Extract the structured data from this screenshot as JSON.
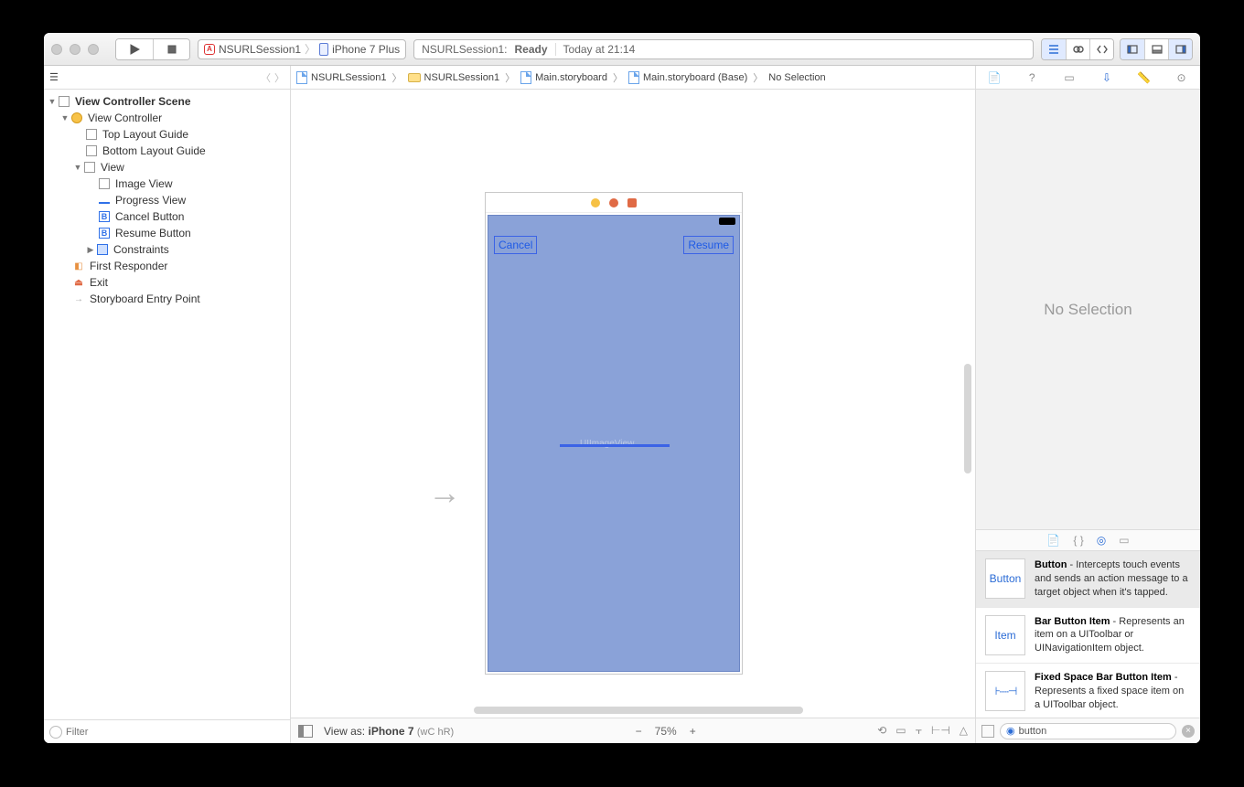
{
  "toolbar": {
    "scheme_target": "NSURLSession1",
    "scheme_device": "iPhone 7 Plus",
    "activity_project": "NSURLSession1:",
    "activity_status": "Ready",
    "activity_time": "Today at 21:14"
  },
  "breadcrumb": {
    "items": [
      "NSURLSession1",
      "NSURLSession1",
      "Main.storyboard",
      "Main.storyboard (Base)",
      "No Selection"
    ]
  },
  "outline": {
    "scene": "View Controller Scene",
    "vc": "View Controller",
    "top_guide": "Top Layout Guide",
    "bottom_guide": "Bottom Layout Guide",
    "view": "View",
    "image_view": "Image View",
    "progress_view": "Progress View",
    "cancel_button": "Cancel Button",
    "resume_button": "Resume Button",
    "constraints": "Constraints",
    "first_responder": "First Responder",
    "exit": "Exit",
    "entry_point": "Storyboard Entry Point"
  },
  "canvas": {
    "cancel_label": "Cancel",
    "resume_label": "Resume",
    "imageview_placeholder": "UIImageView"
  },
  "bottombar": {
    "view_as_prefix": "View as:",
    "view_as_device": "iPhone 7",
    "size_class": "(wC hR)",
    "zoom": "75%"
  },
  "inspector": {
    "no_selection": "No Selection"
  },
  "library": {
    "items": [
      {
        "thumb": "Button",
        "title": "Button",
        "desc": " - Intercepts touch events and sends an action message to a target object when it's tapped."
      },
      {
        "thumb": "Item",
        "title": "Bar Button Item",
        "desc": " - Represents an item on a UIToolbar or UINavigationItem object."
      },
      {
        "thumb": "⋯",
        "title": "Fixed Space Bar Button Item",
        "desc": " - Represents a fixed space item on a UIToolbar object."
      }
    ],
    "filter_value": "button"
  },
  "filter": {
    "placeholder": "Filter"
  }
}
